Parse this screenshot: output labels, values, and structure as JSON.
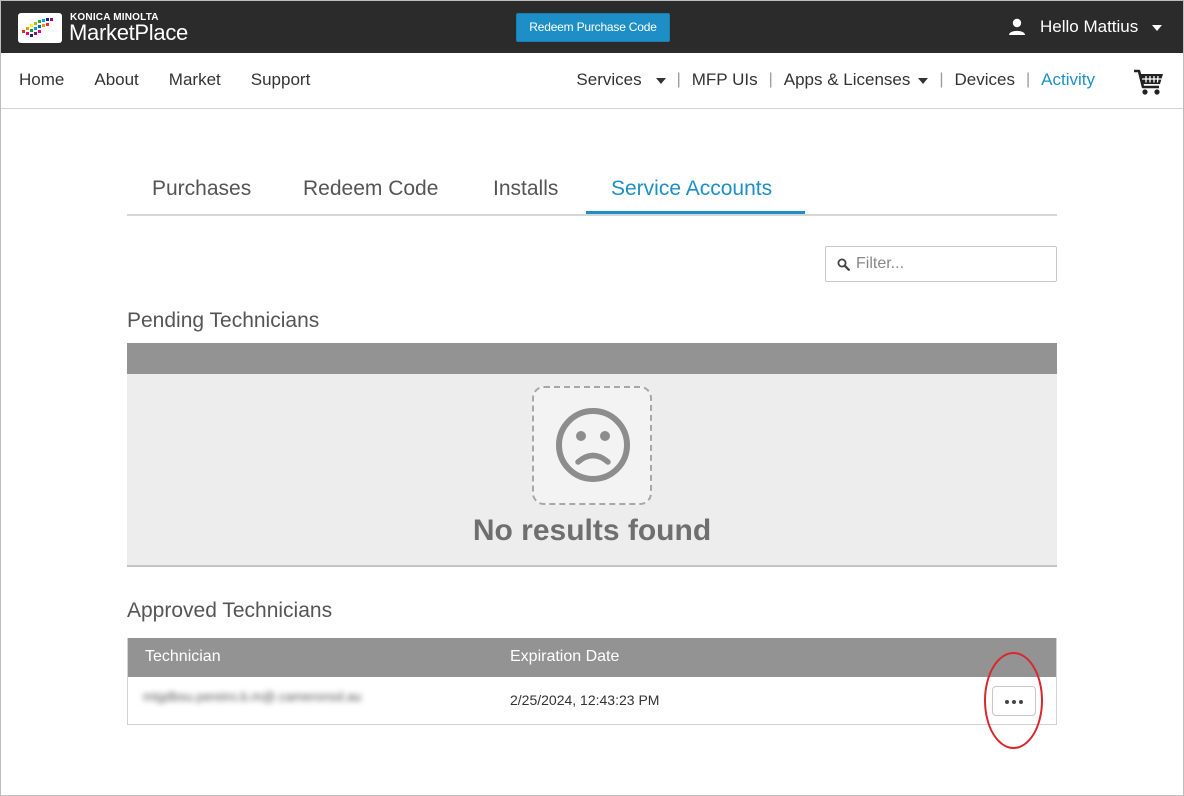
{
  "brand": {
    "company": "KONICA MINOLTA",
    "product": "MarketPlace"
  },
  "topbar": {
    "redeem_button": "Redeem Purchase Code",
    "user_greeting": "Hello Mattius"
  },
  "nav": {
    "left": [
      "Home",
      "About",
      "Market",
      "Support"
    ],
    "services": "Services",
    "mfp_uis": "MFP UIs",
    "apps_licenses": "Apps & Licenses",
    "devices": "Devices",
    "activity": "Activity",
    "separator": "|"
  },
  "tabs": [
    {
      "label": "Purchases",
      "active": false
    },
    {
      "label": "Redeem Code",
      "active": false
    },
    {
      "label": "Installs",
      "active": false
    },
    {
      "label": "Service Accounts",
      "active": true
    }
  ],
  "filter": {
    "placeholder": "Filter..."
  },
  "pending": {
    "title": "Pending Technicians",
    "empty_message": "No results found"
  },
  "approved": {
    "title": "Approved Technicians",
    "columns": {
      "technician": "Technician",
      "expiration": "Expiration Date"
    },
    "rows": [
      {
        "technician": "mtgdbsu.pereiro.b.m@.cameronsd.au",
        "expiration": "2/25/2024, 12:43:23 PM"
      }
    ]
  },
  "icons": {
    "user": "user-icon",
    "cart": "cart-icon",
    "filter": "search-icon",
    "empty": "sad-face-icon",
    "more": "more-options-icon"
  },
  "colors": {
    "accent": "#1e8fc6",
    "topbar": "#2b2b2b",
    "table_header": "#939393",
    "annotation": "#d8272d"
  }
}
